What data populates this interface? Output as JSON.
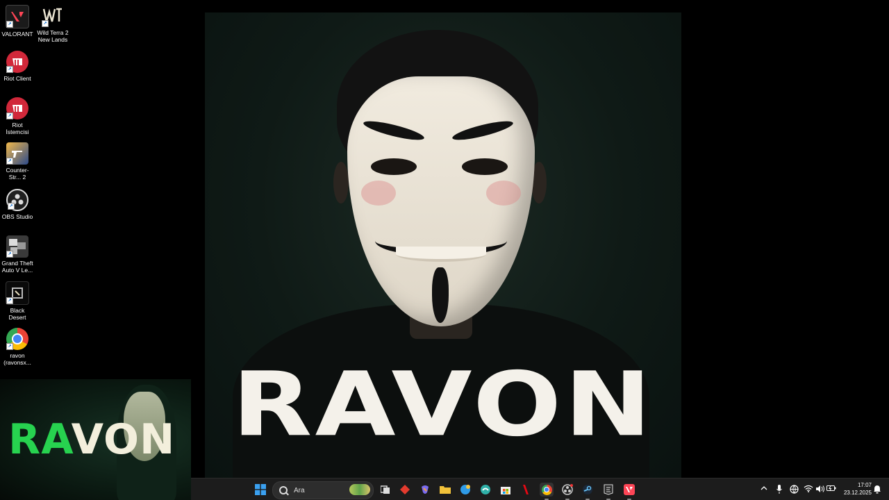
{
  "desktop_icons": [
    {
      "label": "VALORANT",
      "icon": "valorant-icon",
      "color": "#1a1a1a"
    },
    {
      "label": "Wild Terra 2 New Lands",
      "icon": "wild-terra-icon",
      "color": "#000000"
    },
    {
      "label": "Riot Client",
      "icon": "riot-client-icon",
      "color": "#d1283a"
    },
    {
      "label": "Riot İstemcisi",
      "icon": "riot-client-icon",
      "color": "#d1283a"
    },
    {
      "label": "Counter-Str... 2",
      "icon": "counter-strike-icon",
      "color": "#e8a23a"
    },
    {
      "label": "OBS Studio",
      "icon": "obs-icon",
      "color": "#202020"
    },
    {
      "label": "Grand Theft Auto V Le...",
      "icon": "gta-icon",
      "color": "#3a3a3a"
    },
    {
      "label": "Black Desert",
      "icon": "black-desert-icon",
      "color": "#0a0a0a"
    },
    {
      "label": "ravon (ravonsx...",
      "icon": "chrome-profile-icon",
      "color": "#ffffff"
    }
  ],
  "wallpaper": {
    "title": "RAVON"
  },
  "thumbnail": {
    "title_part1": "RA",
    "title_part2": "VON"
  },
  "taskbar": {
    "search_placeholder": "Ara",
    "apps": [
      {
        "name": "task-view-icon",
        "color": "#e0e0e0"
      },
      {
        "name": "gem-app-icon",
        "color": "#e43b2e"
      },
      {
        "name": "copilot-icon",
        "color": "#7b6cf0"
      },
      {
        "name": "file-explorer-icon",
        "color": "#f2c23a"
      },
      {
        "name": "weather-app-icon",
        "color": "#2f9be8"
      },
      {
        "name": "edge-icon",
        "color": "#2fb0a8"
      },
      {
        "name": "microsoft-store-icon",
        "color": "#3a8de8"
      },
      {
        "name": "netflix-icon",
        "color": "#e50914"
      },
      {
        "name": "chrome-icon",
        "color": "#f4c20d"
      },
      {
        "name": "obs-taskbar-icon",
        "color": "#cccccc"
      },
      {
        "name": "steam-icon",
        "color": "#66c0f4"
      },
      {
        "name": "epic-games-icon",
        "color": "#2a2a2a"
      },
      {
        "name": "valorant-taskbar-icon",
        "color": "#fd4556"
      }
    ],
    "clock_time": "17:07",
    "clock_date": "23.12.2025"
  }
}
